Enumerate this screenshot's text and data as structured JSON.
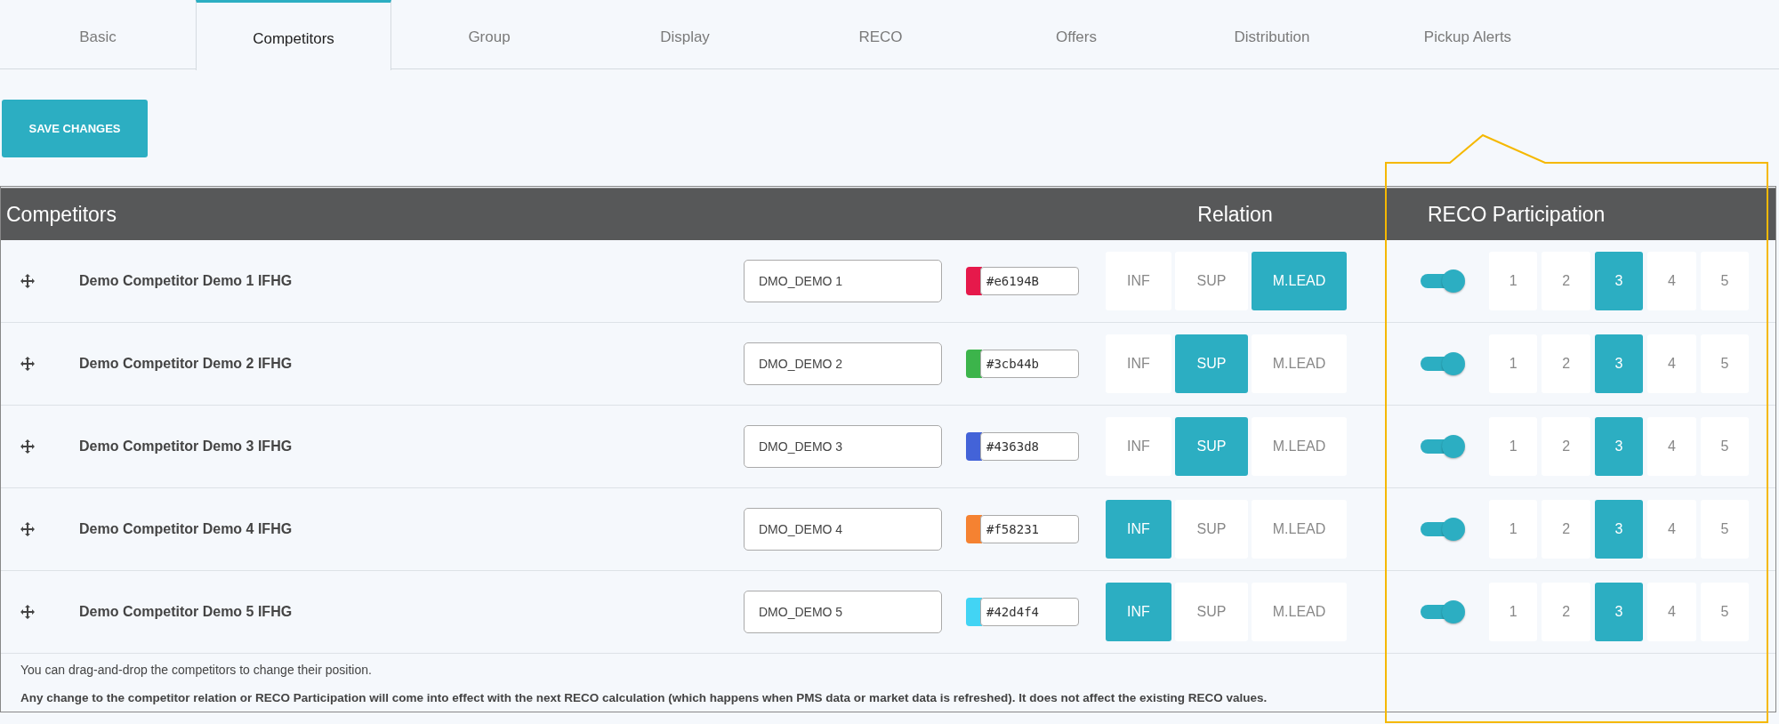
{
  "tabs": [
    {
      "label": "Basic",
      "selected": false
    },
    {
      "label": "Competitors",
      "selected": true
    },
    {
      "label": "Group",
      "selected": false
    },
    {
      "label": "Display",
      "selected": false
    },
    {
      "label": "RECO",
      "selected": false
    },
    {
      "label": "Offers",
      "selected": false
    },
    {
      "label": "Distribution",
      "selected": false
    },
    {
      "label": "Pickup Alerts",
      "selected": false
    }
  ],
  "save_button": "SAVE CHANGES",
  "table": {
    "columns": [
      "Competitors",
      "Relation",
      "RECO Participation"
    ],
    "rows": [
      {
        "name": "Demo Competitor Demo 1 IFHG",
        "code": "DMO_DEMO 1",
        "color": "#e6194b",
        "hex": "#e6194B",
        "relation": [
          {
            "label": "INF",
            "selected": false
          },
          {
            "label": "SUP",
            "selected": false
          },
          {
            "label": "M.LEAD",
            "selected": true
          }
        ],
        "participating": true,
        "weights": [
          {
            "label": "1",
            "selected": false
          },
          {
            "label": "2",
            "selected": false
          },
          {
            "label": "3",
            "selected": true
          },
          {
            "label": "4",
            "selected": false
          },
          {
            "label": "5",
            "selected": false
          }
        ]
      },
      {
        "name": "Demo Competitor Demo 2 IFHG",
        "code": "DMO_DEMO 2",
        "color": "#3cb44b",
        "hex": "#3cb44b",
        "relation": [
          {
            "label": "INF",
            "selected": false
          },
          {
            "label": "SUP",
            "selected": true
          },
          {
            "label": "M.LEAD",
            "selected": false
          }
        ],
        "participating": true,
        "weights": [
          {
            "label": "1",
            "selected": false
          },
          {
            "label": "2",
            "selected": false
          },
          {
            "label": "3",
            "selected": true
          },
          {
            "label": "4",
            "selected": false
          },
          {
            "label": "5",
            "selected": false
          }
        ]
      },
      {
        "name": "Demo Competitor Demo 3 IFHG",
        "code": "DMO_DEMO 3",
        "color": "#4363d8",
        "hex": "#4363d8",
        "relation": [
          {
            "label": "INF",
            "selected": false
          },
          {
            "label": "SUP",
            "selected": true
          },
          {
            "label": "M.LEAD",
            "selected": false
          }
        ],
        "participating": true,
        "weights": [
          {
            "label": "1",
            "selected": false
          },
          {
            "label": "2",
            "selected": false
          },
          {
            "label": "3",
            "selected": true
          },
          {
            "label": "4",
            "selected": false
          },
          {
            "label": "5",
            "selected": false
          }
        ]
      },
      {
        "name": "Demo Competitor Demo 4 IFHG",
        "code": "DMO_DEMO 4",
        "color": "#f58231",
        "hex": "#f58231",
        "relation": [
          {
            "label": "INF",
            "selected": true
          },
          {
            "label": "SUP",
            "selected": false
          },
          {
            "label": "M.LEAD",
            "selected": false
          }
        ],
        "participating": true,
        "weights": [
          {
            "label": "1",
            "selected": false
          },
          {
            "label": "2",
            "selected": false
          },
          {
            "label": "3",
            "selected": true
          },
          {
            "label": "4",
            "selected": false
          },
          {
            "label": "5",
            "selected": false
          }
        ]
      },
      {
        "name": "Demo Competitor Demo 5 IFHG",
        "code": "DMO_DEMO 5",
        "color": "#42d4f4",
        "hex": "#42d4f4",
        "relation": [
          {
            "label": "INF",
            "selected": true
          },
          {
            "label": "SUP",
            "selected": false
          },
          {
            "label": "M.LEAD",
            "selected": false
          }
        ],
        "participating": true,
        "weights": [
          {
            "label": "1",
            "selected": false
          },
          {
            "label": "2",
            "selected": false
          },
          {
            "label": "3",
            "selected": true
          },
          {
            "label": "4",
            "selected": false
          },
          {
            "label": "5",
            "selected": false
          }
        ]
      }
    ]
  },
  "notes": [
    "You can drag-and-drop the competitors to change their position.",
    "Any change to the competitor relation or RECO Participation will come into effect with the next RECO calculation (which happens when PMS data or market data is refreshed). It does not affect the existing RECO values."
  ]
}
